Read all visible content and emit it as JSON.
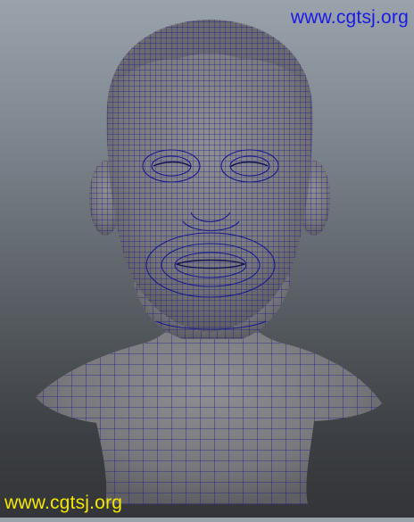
{
  "scene": {
    "subject": "male-head-bust-wireframe-mesh",
    "background_top_color": "#9aa2ab",
    "background_bottom_color": "#333538",
    "mesh_fill_color": "#7c7c80",
    "wire_color": "#1b1b8c"
  },
  "watermarks": {
    "top_text": "www.cgtsj.org",
    "top_color": "#1a1ae6",
    "bottom_text": "www.cgtsj.org",
    "bottom_color": "#f4e800"
  }
}
